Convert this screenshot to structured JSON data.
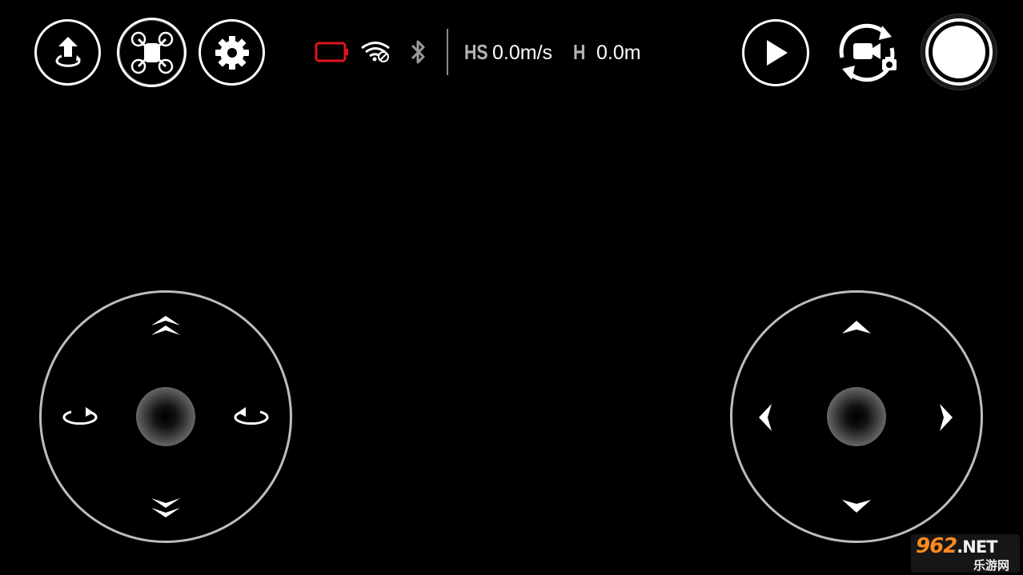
{
  "top_bar": {
    "left_buttons": [
      {
        "name": "takeoff",
        "icon": "takeoff-icon"
      },
      {
        "name": "drone-mode",
        "icon": "drone-icon"
      },
      {
        "name": "settings",
        "icon": "gear-icon"
      }
    ],
    "status": {
      "battery_icon": "battery-empty-icon",
      "battery_color": "#e0141e",
      "wifi_icon": "wifi-disconnected-icon",
      "bluetooth_icon": "bluetooth-icon"
    },
    "telemetry": {
      "hs_label": "HS",
      "hs_value": "0.0m/s",
      "h_label": "H",
      "h_value": "0.0m"
    },
    "right_buttons": [
      {
        "name": "playback",
        "icon": "play-icon"
      },
      {
        "name": "camera-mode-switch",
        "icon": "video-camera-switch-icon"
      },
      {
        "name": "shutter",
        "icon": "shutter-button"
      }
    ]
  },
  "joysticks": {
    "left": {
      "up": "ascend-icon",
      "down": "descend-icon",
      "left": "rotate-left-icon",
      "right": "rotate-right-icon"
    },
    "right": {
      "up": "forward-icon",
      "down": "backward-icon",
      "left": "left-icon",
      "right": "right-icon"
    }
  },
  "watermark": {
    "main": "962",
    "suffix": ".NET",
    "sub": "乐游网"
  }
}
